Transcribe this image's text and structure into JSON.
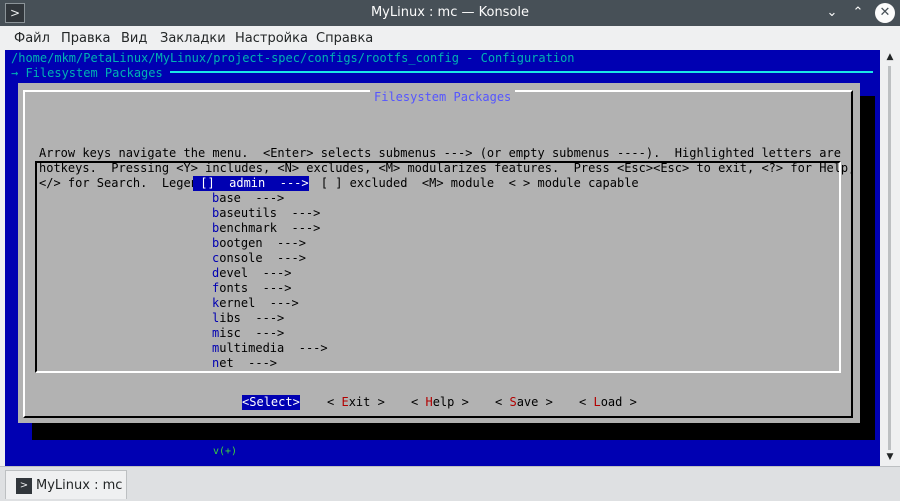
{
  "window": {
    "title": "MyLinux : mc — Konsole",
    "buttons": {
      "minimize": "⌄",
      "maximize": "⌃",
      "close": "✕"
    }
  },
  "menubar": [
    "Файл",
    "Правка",
    "Вид",
    "Закладки",
    "Настройка",
    "Справка"
  ],
  "terminal": {
    "path": "/home/mkm/PetaLinux/MyLinux/project-spec/configs/rootfs_config - Configuration",
    "breadcrumb": "→ Filesystem Packages",
    "dialog_title": "Filesystem Packages",
    "help_lines": [
      "Arrow keys navigate the menu.  <Enter> selects submenus ---> (or empty submenus ----).  Highlighted letters are",
      "hotkeys.  Pressing <Y> includes, <N> excludes, <M> modularizes features.  Press <Esc><Esc> to exit, <?> for Help,",
      "</> for Search.  Legend: [*] built-in  [ ] excluded  <M> module  < > module capable"
    ],
    "menu_items": [
      {
        "hot": "a",
        "rest": "dmin",
        "suffix": "  --->",
        "selected": true
      },
      {
        "hot": "b",
        "rest": "ase",
        "suffix": "  --->",
        "selected": false
      },
      {
        "hot": "b",
        "rest": "aseutils",
        "suffix": "  --->",
        "selected": false
      },
      {
        "hot": "b",
        "rest": "enchmark",
        "suffix": "  --->",
        "selected": false
      },
      {
        "hot": "b",
        "rest": "ootgen",
        "suffix": "  --->",
        "selected": false
      },
      {
        "hot": "c",
        "rest": "onsole",
        "suffix": "  --->",
        "selected": false
      },
      {
        "hot": "d",
        "rest": "evel",
        "suffix": "  --->",
        "selected": false
      },
      {
        "hot": "f",
        "rest": "onts",
        "suffix": "  --->",
        "selected": false
      },
      {
        "hot": "k",
        "rest": "ernel",
        "suffix": "  --->",
        "selected": false
      },
      {
        "hot": "l",
        "rest": "ibs",
        "suffix": "  --->",
        "selected": false
      },
      {
        "hot": "m",
        "rest": "isc",
        "suffix": "  --->",
        "selected": false
      },
      {
        "hot": "m",
        "rest": "ultimedia",
        "suffix": "  --->",
        "selected": false
      },
      {
        "hot": "n",
        "rest": "et",
        "suffix": "  --->",
        "selected": false
      }
    ],
    "scroll_more": "v(+)",
    "buttons": [
      {
        "pre": "<",
        "hot": "S",
        "post": "elect>",
        "selected": true
      },
      {
        "pre": "< ",
        "hot": "E",
        "post": "xit >",
        "selected": false
      },
      {
        "pre": "< ",
        "hot": "H",
        "post": "elp >",
        "selected": false
      },
      {
        "pre": "< ",
        "hot": "S",
        "post": "ave >",
        "selected": false
      },
      {
        "pre": "< ",
        "hot": "L",
        "post": "oad >",
        "selected": false
      }
    ]
  },
  "tabs": [
    {
      "label": "MyLinux : mc"
    }
  ],
  "colors": {
    "terminal_bg": "#0000b2",
    "dialog_bg": "#b2b2b2",
    "dialog_title": "#5555ff",
    "hotkey_button": "#b20000",
    "titlebar": "#475057"
  }
}
